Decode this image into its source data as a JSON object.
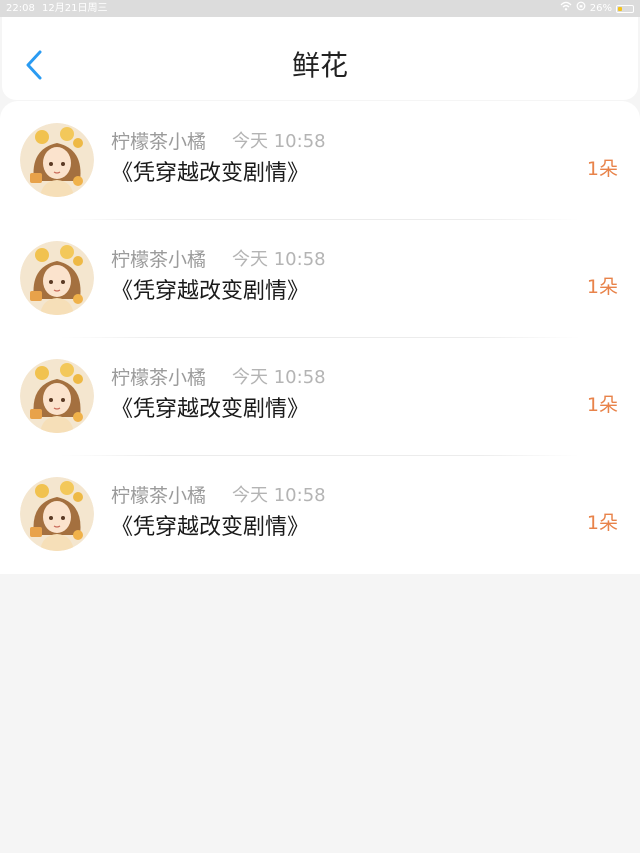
{
  "status_bar": {
    "time": "22:08",
    "date": "12月21日周三",
    "battery_text": "26%",
    "battery_level": 0.26,
    "icons": [
      "wifi-icon",
      "rotation-lock-icon",
      "battery-icon"
    ]
  },
  "nav": {
    "title": "鲜花",
    "back_icon": "chevron-left-icon",
    "accent_color": "#2a9bf2"
  },
  "items": [
    {
      "name": "柠檬茶小橘",
      "time": "今天 10:58",
      "book": "《凭穿越改变剧情》",
      "count": "1朵"
    },
    {
      "name": "柠檬茶小橘",
      "time": "今天 10:58",
      "book": "《凭穿越改变剧情》",
      "count": "1朵"
    },
    {
      "name": "柠檬茶小橘",
      "time": "今天 10:58",
      "book": "《凭穿越改变剧情》",
      "count": "1朵"
    },
    {
      "name": "柠檬茶小橘",
      "time": "今天 10:58",
      "book": "《凭穿越改变剧情》",
      "count": "1朵"
    }
  ],
  "colors": {
    "count": "#e8834a",
    "name": "#9b9b9b",
    "background": "#f5f5f5"
  }
}
